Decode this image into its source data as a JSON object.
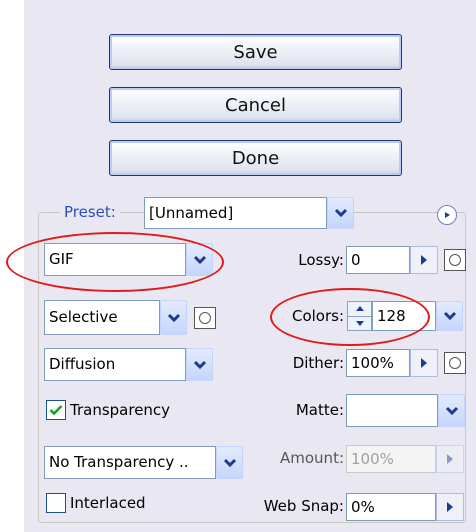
{
  "buttons": {
    "save": "Save",
    "cancel": "Cancel",
    "done": "Done"
  },
  "preset": {
    "label": "Preset:",
    "value": "[Unnamed]"
  },
  "format": {
    "value": "GIF"
  },
  "reduction": {
    "value": "Selective"
  },
  "dither_algorithm": {
    "value": "Diffusion"
  },
  "transparency": {
    "label": "Transparency",
    "checked": true
  },
  "transparency_dither": {
    "value": "No Transparency .."
  },
  "interlaced": {
    "label": "Interlaced",
    "checked": false
  },
  "lossy": {
    "label": "Lossy:",
    "value": "0"
  },
  "colors": {
    "label": "Colors:",
    "value": "128"
  },
  "dither": {
    "label": "Dither:",
    "value": "100%"
  },
  "matte": {
    "label": "Matte:",
    "value": ""
  },
  "amount": {
    "label": "Amount:",
    "value": "100%"
  },
  "web_snap": {
    "label": "Web Snap:",
    "value": "0%"
  },
  "accent_colors": {
    "annotation_red": "#e01b1b",
    "preset_blue": "#2d4fb8",
    "button_border": "#25356b"
  }
}
